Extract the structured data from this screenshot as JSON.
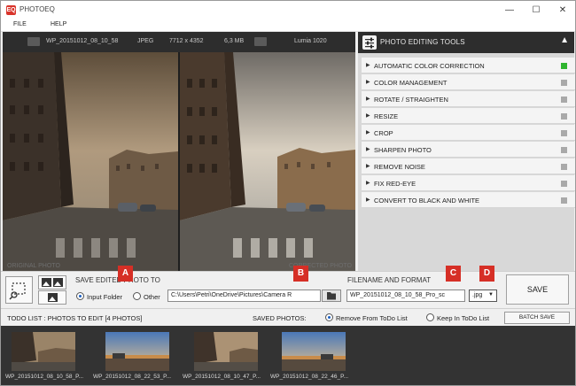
{
  "app": {
    "title": "PHOTOEQ",
    "icon_text": "EQ",
    "icon": "photoeq-logo"
  },
  "window_controls": {
    "minimize": "—",
    "maximize": "☐",
    "close": "✕"
  },
  "menu": [
    "FILE",
    "HELP"
  ],
  "image_info": {
    "filename": "WP_20151012_08_10_58",
    "format": "JPEG",
    "dimensions": "7712 x 4352",
    "size": "6,3 MB",
    "camera": "Lumia 1020"
  },
  "preview": {
    "original_label": "ORIGINAL PHOTO",
    "corrected_label": "CORRECTED PHOTO"
  },
  "tools": {
    "title": "PHOTO EDITING TOOLS",
    "items": [
      {
        "label": "AUTOMATIC COLOR CORRECTION",
        "active": true
      },
      {
        "label": "COLOR MANAGEMENT",
        "active": false
      },
      {
        "label": "ROTATE / STRAIGHTEN",
        "active": false
      },
      {
        "label": "RESIZE",
        "active": false
      },
      {
        "label": "CROP",
        "active": false
      },
      {
        "label": "SHARPEN PHOTO",
        "active": false
      },
      {
        "label": "REMOVE NOISE",
        "active": false
      },
      {
        "label": "FIX RED-EYE",
        "active": false
      },
      {
        "label": "CONVERT TO BLACK AND WHITE",
        "active": false
      }
    ],
    "active_color": "#2fb52f",
    "inactive_color": "#a9a9a9"
  },
  "save": {
    "title": "SAVE EDITED PHOTO TO",
    "options": [
      "Input Folder",
      "Other"
    ],
    "selected": "Input Folder",
    "path": "C:\\Users\\Petri\\OneDrive\\Pictures\\Camera R",
    "filename_title": "FILENAME AND FORMAT",
    "filename": "WP_20151012_08_10_58_Pro_sc",
    "extension": ".jpg",
    "save_button": "SAVE"
  },
  "markers": [
    "A",
    "B",
    "C",
    "D"
  ],
  "todo": {
    "title": "TODO LIST : PHOTOS TO EDIT   [4 PHOTOS]",
    "saved_title": "SAVED PHOTOS:",
    "saved_options": [
      "Remove From ToDo List",
      "Keep In ToDo List"
    ],
    "saved_selected": "Remove From ToDo List",
    "batch_button": "BATCH SAVE",
    "thumbnails": [
      "WP_20151012_08_10_58_P...",
      "WP_20151012_08_22_53_P...",
      "WP_20151012_08_10_47_P...",
      "WP_20151012_08_22_46_P..."
    ]
  }
}
